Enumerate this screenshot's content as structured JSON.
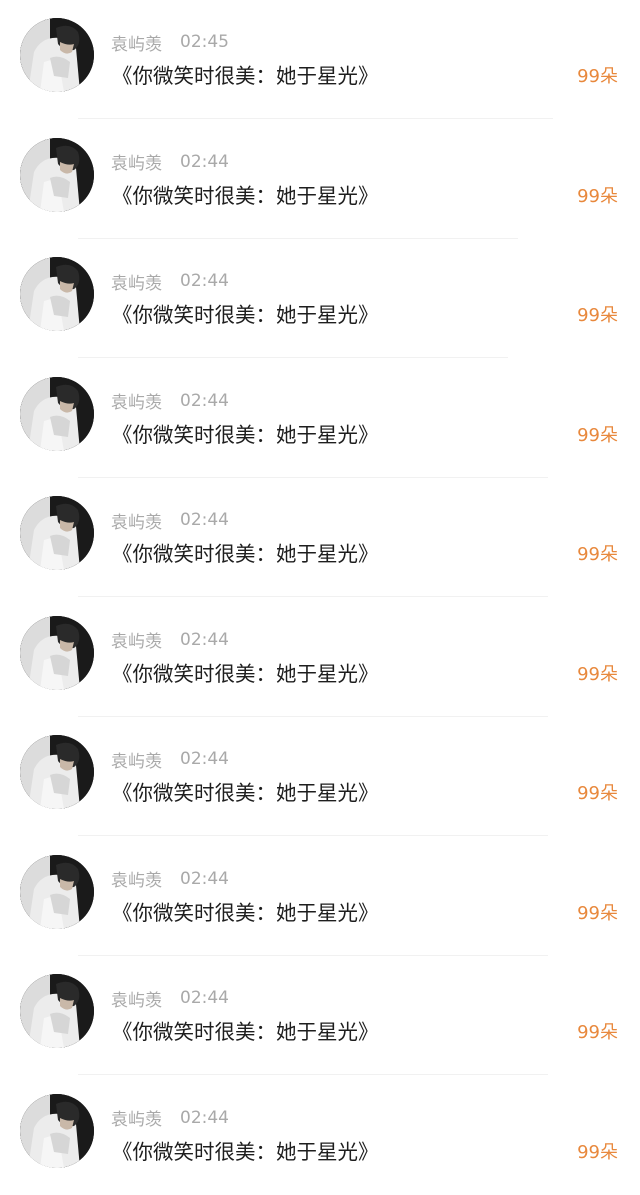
{
  "messages": [
    {
      "name": "袁屿羡",
      "time": "02:45",
      "text": "《你微笑时很美：她于星光》",
      "gift": "99朵"
    },
    {
      "name": "袁屿羡",
      "time": "02:44",
      "text": "《你微笑时很美：她于星光》",
      "gift": "99朵"
    },
    {
      "name": "袁屿羡",
      "time": "02:44",
      "text": "《你微笑时很美：她于星光》",
      "gift": "99朵"
    },
    {
      "name": "袁屿羡",
      "time": "02:44",
      "text": "《你微笑时很美：她于星光》",
      "gift": "99朵"
    },
    {
      "name": "袁屿羡",
      "time": "02:44",
      "text": "《你微笑时很美：她于星光》",
      "gift": "99朵"
    },
    {
      "name": "袁屿羡",
      "time": "02:44",
      "text": "《你微笑时很美：她于星光》",
      "gift": "99朵"
    },
    {
      "name": "袁屿羡",
      "time": "02:44",
      "text": "《你微笑时很美：她于星光》",
      "gift": "99朵"
    },
    {
      "name": "袁屿羡",
      "time": "02:44",
      "text": "《你微笑时很美：她于星光》",
      "gift": "99朵"
    },
    {
      "name": "袁屿羡",
      "time": "02:44",
      "text": "《你微笑时很美：她于星光》",
      "gift": "99朵"
    },
    {
      "name": "袁屿羡",
      "time": "02:44",
      "text": "《你微笑时很美：她于星光》",
      "gift": "99朵"
    }
  ],
  "colors": {
    "gift": "#e8883c",
    "meta": "#a9a9a9",
    "text": "#1e1e1e",
    "divider": "#f1f1f1"
  },
  "icons": {
    "avatar": "user-avatar-photo"
  }
}
